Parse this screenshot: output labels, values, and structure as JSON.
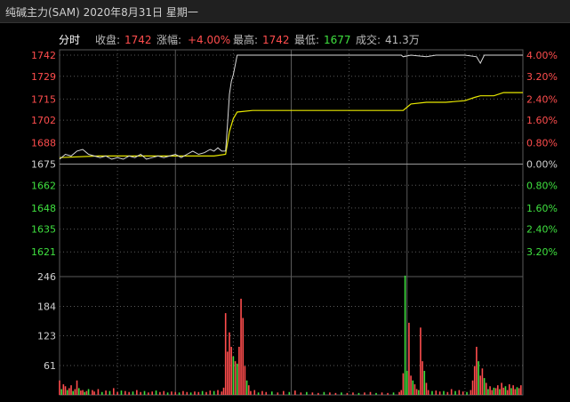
{
  "title": "纯碱主力(SAM) 2020年8月31日 星期一",
  "info_bar": {
    "tab": "分时",
    "close_label": "收盘:",
    "close_value": "1742",
    "change_label": "涨幅:",
    "change_value": "+4.00%",
    "high_label": "最高:",
    "high_value": "1742",
    "low_label": "最低:",
    "low_value": "1677",
    "volume_label": "成交:",
    "volume_value": "41.3万"
  },
  "colors": {
    "up": "#ff4d4d",
    "down": "#3fe03f",
    "price_line": "#d8d8d8",
    "avg_line": "#e8e800",
    "grid": "#5a5a5a"
  },
  "chart_data": {
    "type": "line",
    "price_axis": {
      "left_ticks": [
        "1742",
        "1729",
        "1715",
        "1702",
        "1688",
        "1675",
        "1662",
        "1648",
        "1635",
        "1621"
      ],
      "left_tick_values": [
        1742,
        1729,
        1715,
        1702,
        1688,
        1675,
        1662,
        1648,
        1635,
        1621
      ],
      "right_ticks": [
        "4.00%",
        "3.20%",
        "2.40%",
        "1.60%",
        "0.80%",
        "0.00%",
        "0.80%",
        "1.60%",
        "2.40%",
        "3.20%"
      ],
      "range": [
        1608,
        1742
      ],
      "base": 1675
    },
    "volume_axis": {
      "ticks": [
        "246",
        "184",
        "123",
        "61"
      ],
      "tick_values": [
        246,
        184,
        123,
        61
      ],
      "range": [
        0,
        246
      ]
    },
    "price_series": [
      [
        0,
        1678
      ],
      [
        3,
        1681
      ],
      [
        6,
        1680
      ],
      [
        9,
        1683
      ],
      [
        12,
        1684
      ],
      [
        15,
        1681
      ],
      [
        18,
        1680
      ],
      [
        21,
        1679
      ],
      [
        24,
        1680
      ],
      [
        27,
        1678
      ],
      [
        30,
        1679
      ],
      [
        33,
        1678
      ],
      [
        36,
        1680
      ],
      [
        39,
        1679
      ],
      [
        42,
        1681
      ],
      [
        45,
        1678
      ],
      [
        48,
        1679
      ],
      [
        51,
        1680
      ],
      [
        54,
        1679
      ],
      [
        57,
        1680
      ],
      [
        60,
        1681
      ],
      [
        63,
        1679
      ],
      [
        66,
        1681
      ],
      [
        69,
        1683
      ],
      [
        72,
        1681
      ],
      [
        75,
        1682
      ],
      [
        78,
        1684
      ],
      [
        80,
        1683
      ],
      [
        82,
        1685
      ],
      [
        84,
        1683
      ],
      [
        86,
        1683
      ],
      [
        87,
        1700
      ],
      [
        88,
        1718
      ],
      [
        89,
        1726
      ],
      [
        90,
        1730
      ],
      [
        92,
        1742
      ],
      [
        100,
        1742
      ],
      [
        120,
        1742
      ],
      [
        140,
        1742
      ],
      [
        160,
        1742
      ],
      [
        177,
        1742
      ],
      [
        178,
        1741
      ],
      [
        182,
        1742
      ],
      [
        190,
        1741
      ],
      [
        195,
        1742
      ],
      [
        200,
        1742
      ],
      [
        210,
        1742
      ],
      [
        216,
        1741
      ],
      [
        218,
        1737
      ],
      [
        220,
        1742
      ],
      [
        230,
        1742
      ],
      [
        240,
        1742
      ]
    ],
    "avg_series": [
      [
        0,
        1679
      ],
      [
        20,
        1680
      ],
      [
        40,
        1680
      ],
      [
        60,
        1680
      ],
      [
        80,
        1680
      ],
      [
        86,
        1681
      ],
      [
        88,
        1695
      ],
      [
        90,
        1703
      ],
      [
        92,
        1707
      ],
      [
        100,
        1708
      ],
      [
        120,
        1708
      ],
      [
        140,
        1708
      ],
      [
        160,
        1708
      ],
      [
        178,
        1708
      ],
      [
        180,
        1710
      ],
      [
        182,
        1712
      ],
      [
        190,
        1713
      ],
      [
        200,
        1713
      ],
      [
        210,
        1714
      ],
      [
        215,
        1716
      ],
      [
        218,
        1717
      ],
      [
        225,
        1717
      ],
      [
        230,
        1719
      ],
      [
        240,
        1719
      ]
    ],
    "volume": [
      [
        0,
        30,
        "up"
      ],
      [
        1,
        12,
        "down"
      ],
      [
        2,
        22,
        "up"
      ],
      [
        3,
        18,
        "up"
      ],
      [
        4,
        10,
        "down"
      ],
      [
        5,
        14,
        "up"
      ],
      [
        6,
        20,
        "up"
      ],
      [
        7,
        8,
        "down"
      ],
      [
        8,
        12,
        "up"
      ],
      [
        9,
        30,
        "up"
      ],
      [
        10,
        14,
        "down"
      ],
      [
        11,
        9,
        "up"
      ],
      [
        12,
        10,
        "up"
      ],
      [
        13,
        6,
        "down"
      ],
      [
        14,
        8,
        "up"
      ],
      [
        15,
        12,
        "down"
      ],
      [
        17,
        10,
        "up"
      ],
      [
        18,
        7,
        "up"
      ],
      [
        20,
        12,
        "up"
      ],
      [
        22,
        6,
        "down"
      ],
      [
        24,
        9,
        "up"
      ],
      [
        26,
        8,
        "down"
      ],
      [
        28,
        14,
        "up"
      ],
      [
        30,
        6,
        "up"
      ],
      [
        32,
        9,
        "down"
      ],
      [
        34,
        8,
        "up"
      ],
      [
        36,
        6,
        "up"
      ],
      [
        38,
        7,
        "down"
      ],
      [
        40,
        10,
        "up"
      ],
      [
        42,
        6,
        "up"
      ],
      [
        44,
        8,
        "down"
      ],
      [
        46,
        5,
        "up"
      ],
      [
        48,
        7,
        "up"
      ],
      [
        50,
        9,
        "down"
      ],
      [
        52,
        6,
        "up"
      ],
      [
        54,
        8,
        "up"
      ],
      [
        56,
        5,
        "down"
      ],
      [
        58,
        7,
        "up"
      ],
      [
        60,
        6,
        "up"
      ],
      [
        62,
        5,
        "down"
      ],
      [
        64,
        8,
        "up"
      ],
      [
        66,
        6,
        "up"
      ],
      [
        68,
        5,
        "down"
      ],
      [
        70,
        7,
        "up"
      ],
      [
        72,
        6,
        "up"
      ],
      [
        74,
        8,
        "down"
      ],
      [
        76,
        6,
        "up"
      ],
      [
        78,
        9,
        "up"
      ],
      [
        80,
        8,
        "down"
      ],
      [
        82,
        10,
        "up"
      ],
      [
        84,
        7,
        "up"
      ],
      [
        85,
        15,
        "up"
      ],
      [
        86,
        170,
        "up"
      ],
      [
        87,
        90,
        "up"
      ],
      [
        88,
        130,
        "up"
      ],
      [
        89,
        100,
        "up"
      ],
      [
        90,
        80,
        "down"
      ],
      [
        91,
        70,
        "up"
      ],
      [
        92,
        65,
        "down"
      ],
      [
        93,
        100,
        "up"
      ],
      [
        94,
        200,
        "up"
      ],
      [
        95,
        160,
        "up"
      ],
      [
        96,
        60,
        "up"
      ],
      [
        97,
        30,
        "down"
      ],
      [
        98,
        20,
        "up"
      ],
      [
        99,
        8,
        "up"
      ],
      [
        101,
        10,
        "up"
      ],
      [
        103,
        5,
        "down"
      ],
      [
        105,
        8,
        "up"
      ],
      [
        107,
        6,
        "up"
      ],
      [
        110,
        7,
        "down"
      ],
      [
        113,
        5,
        "up"
      ],
      [
        116,
        8,
        "up"
      ],
      [
        119,
        6,
        "down"
      ],
      [
        122,
        9,
        "up"
      ],
      [
        125,
        5,
        "up"
      ],
      [
        128,
        6,
        "down"
      ],
      [
        131,
        5,
        "up"
      ],
      [
        134,
        4,
        "up"
      ],
      [
        137,
        6,
        "down"
      ],
      [
        140,
        5,
        "up"
      ],
      [
        143,
        4,
        "up"
      ],
      [
        146,
        5,
        "down"
      ],
      [
        149,
        4,
        "up"
      ],
      [
        152,
        5,
        "up"
      ],
      [
        155,
        4,
        "down"
      ],
      [
        158,
        5,
        "up"
      ],
      [
        161,
        6,
        "up"
      ],
      [
        164,
        4,
        "down"
      ],
      [
        167,
        5,
        "up"
      ],
      [
        170,
        4,
        "up"
      ],
      [
        173,
        5,
        "down"
      ],
      [
        176,
        6,
        "up"
      ],
      [
        177,
        10,
        "up"
      ],
      [
        178,
        45,
        "up"
      ],
      [
        179,
        248,
        "down"
      ],
      [
        180,
        50,
        "down"
      ],
      [
        181,
        150,
        "up"
      ],
      [
        182,
        40,
        "up"
      ],
      [
        183,
        30,
        "down"
      ],
      [
        184,
        22,
        "up"
      ],
      [
        185,
        12,
        "up"
      ],
      [
        186,
        10,
        "down"
      ],
      [
        187,
        140,
        "up"
      ],
      [
        188,
        70,
        "up"
      ],
      [
        189,
        50,
        "down"
      ],
      [
        190,
        25,
        "up"
      ],
      [
        191,
        10,
        "up"
      ],
      [
        193,
        8,
        "down"
      ],
      [
        195,
        9,
        "up"
      ],
      [
        197,
        7,
        "up"
      ],
      [
        199,
        8,
        "down"
      ],
      [
        201,
        6,
        "up"
      ],
      [
        203,
        12,
        "up"
      ],
      [
        205,
        8,
        "down"
      ],
      [
        207,
        10,
        "up"
      ],
      [
        209,
        7,
        "up"
      ],
      [
        211,
        6,
        "down"
      ],
      [
        213,
        10,
        "up"
      ],
      [
        214,
        30,
        "up"
      ],
      [
        215,
        60,
        "up"
      ],
      [
        216,
        100,
        "up"
      ],
      [
        217,
        70,
        "down"
      ],
      [
        218,
        40,
        "up"
      ],
      [
        219,
        55,
        "up"
      ],
      [
        220,
        35,
        "down"
      ],
      [
        221,
        25,
        "up"
      ],
      [
        222,
        12,
        "down"
      ],
      [
        223,
        18,
        "up"
      ],
      [
        224,
        10,
        "up"
      ],
      [
        225,
        15,
        "down"
      ],
      [
        226,
        14,
        "up"
      ],
      [
        227,
        20,
        "up"
      ],
      [
        228,
        12,
        "down"
      ],
      [
        229,
        25,
        "up"
      ],
      [
        230,
        15,
        "up"
      ],
      [
        231,
        18,
        "down"
      ],
      [
        232,
        10,
        "up"
      ],
      [
        233,
        22,
        "up"
      ],
      [
        234,
        14,
        "down"
      ],
      [
        235,
        20,
        "up"
      ],
      [
        236,
        12,
        "up"
      ],
      [
        237,
        16,
        "down"
      ],
      [
        238,
        14,
        "up"
      ],
      [
        239,
        20,
        "up"
      ]
    ]
  }
}
